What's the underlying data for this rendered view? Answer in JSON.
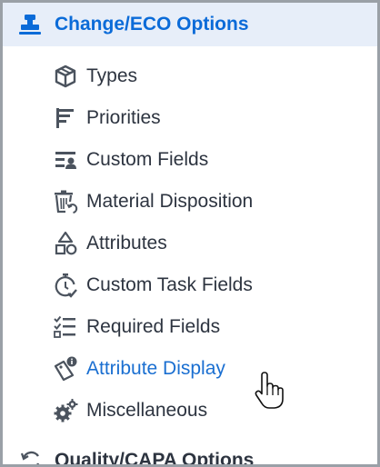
{
  "section": {
    "title": "Change/ECO Options",
    "icon": "stamp-icon"
  },
  "items": [
    {
      "label": "Types",
      "icon": "cube-icon"
    },
    {
      "label": "Priorities",
      "icon": "bars-icon"
    },
    {
      "label": "Custom Fields",
      "icon": "custom-fields-icon"
    },
    {
      "label": "Material Disposition",
      "icon": "trash-recycle-icon"
    },
    {
      "label": "Attributes",
      "icon": "shapes-icon"
    },
    {
      "label": "Custom Task Fields",
      "icon": "timer-check-icon"
    },
    {
      "label": "Required Fields",
      "icon": "checklist-icon"
    },
    {
      "label": "Attribute Display",
      "icon": "tag-info-icon"
    },
    {
      "label": "Miscellaneous",
      "icon": "gears-icon"
    }
  ],
  "next_section": {
    "title": "Quality/CAPA Options",
    "icon": "refresh-icon"
  },
  "colors": {
    "header_bg": "#e7eef9",
    "accent": "#0b6bd8",
    "text": "#2d3440",
    "icon": "#4b535e"
  }
}
